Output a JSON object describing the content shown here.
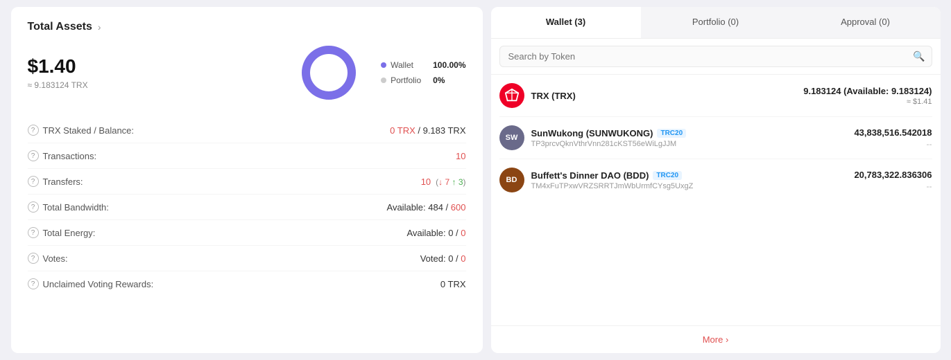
{
  "left": {
    "title": "Total Assets",
    "usd": "$1.40",
    "trx_equiv": "≈ 9.183124 TRX",
    "donut": {
      "wallet_pct": 100,
      "portfolio_pct": 0,
      "wallet_color": "#7b6fe8",
      "portfolio_color": "#e0e0e0"
    },
    "legend": [
      {
        "label": "Wallet",
        "value": "100.00%",
        "color": "#7b6fe8"
      },
      {
        "label": "Portfolio",
        "value": "0%",
        "color": "#e0e0e0"
      }
    ],
    "stats": [
      {
        "id": "trx-staked",
        "label": "TRX Staked / Balance:",
        "value": "0 TRX / 9.183 TRX",
        "value_colored": true,
        "red_part": "0 TRX",
        "normal_part": "/ 9.183 TRX"
      },
      {
        "id": "transactions",
        "label": "Transactions:",
        "value": "10",
        "red": true
      },
      {
        "id": "transfers",
        "label": "Transfers:",
        "value": "10",
        "sub": "( ↓ 7  ↑ 3 )",
        "red": true
      },
      {
        "id": "total-bandwidth",
        "label": "Total Bandwidth:",
        "value_prefix": "Available: ",
        "available": "484",
        "total": "600",
        "total_red": true
      },
      {
        "id": "total-energy",
        "label": "Total Energy:",
        "value_prefix": "Available: ",
        "available": "0",
        "total": "0",
        "total_red": true
      },
      {
        "id": "votes",
        "label": "Votes:",
        "value_prefix": "Voted: ",
        "available": "0",
        "total": "0",
        "total_red": true
      },
      {
        "id": "unclaimed-rewards",
        "label": "Unclaimed Voting Rewards:",
        "value": "0 TRX"
      }
    ]
  },
  "right": {
    "tabs": [
      {
        "id": "wallet",
        "label": "Wallet (3)",
        "active": true
      },
      {
        "id": "portfolio",
        "label": "Portfolio (0)",
        "active": false
      },
      {
        "id": "approval",
        "label": "Approval (0)",
        "active": false
      }
    ],
    "search_placeholder": "Search by Token",
    "tokens": [
      {
        "id": "trx",
        "symbol": "TRX",
        "name": "TRX (TRX)",
        "badge": null,
        "address": null,
        "balance": "9.183124 (Available: 9.183124)",
        "usd": "≈ $1.41",
        "icon_type": "svg"
      },
      {
        "id": "sunwukong",
        "symbol": "SW",
        "name": "SunWukong (SUNWUKONG)",
        "badge": "TRC20",
        "address": "TP3prcvQknVthrVnn281cKST56eWiLgJJM",
        "balance": "43,838,516.542018",
        "usd": "--",
        "icon_type": "circle",
        "icon_color": "#555"
      },
      {
        "id": "bdd",
        "symbol": "BDD",
        "name": "Buffett's Dinner DAO (BDD)",
        "badge": "TRC20",
        "address": "TM4xFuTPxwVRZSRRTJmWbUrmfCYsg5UxgZ",
        "balance": "20,783,322.836306",
        "usd": "--",
        "icon_type": "circle",
        "icon_color": "#8B4513"
      }
    ],
    "more_label": "More ›"
  }
}
